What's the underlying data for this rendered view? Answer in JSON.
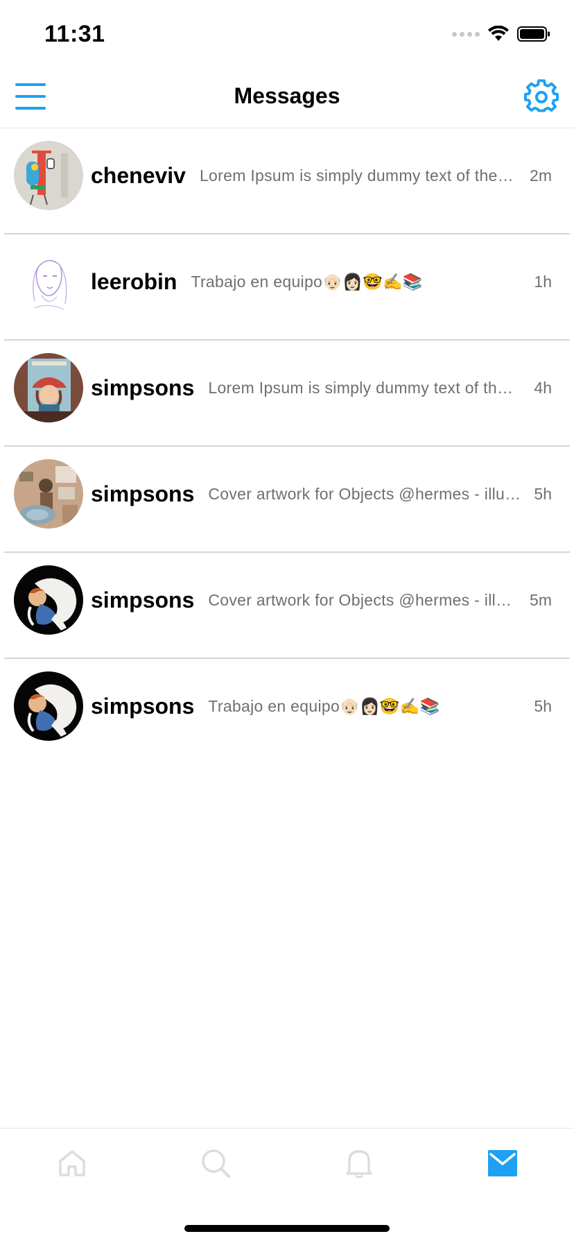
{
  "status_bar": {
    "time": "11:31"
  },
  "header": {
    "title": "Messages"
  },
  "messages": [
    {
      "username": "cheneviv",
      "preview": "Lorem Ipsum is simply dummy text of the printing and typesetting industry",
      "time": "2m",
      "avatar_icon": "robot-illustration-avatar"
    },
    {
      "username": "leerobin",
      "preview": "Trabajo en equipo👴🏻👩🏻🤓✍️📚",
      "time": "1h",
      "avatar_icon": "sketch-portrait-avatar"
    },
    {
      "username": "simpsons",
      "preview": "Lorem Ipsum is simply dummy text of the printing and typesetting industry",
      "time": "4h",
      "avatar_icon": "book-girl-avatar"
    },
    {
      "username": "simpsons",
      "preview": "Cover artwork for Objects @hermes - illustration",
      "time": "5h",
      "avatar_icon": "room-illustration-avatar"
    },
    {
      "username": "simpsons",
      "preview": "Cover artwork for Objects @hermes - illustration",
      "time": "5m",
      "avatar_icon": "sleeping-figure-avatar"
    },
    {
      "username": "simpsons",
      "preview": "Trabajo en equipo👴🏻👩🏻🤓✍️📚",
      "time": "5h",
      "avatar_icon": "sleeping-figure-avatar"
    }
  ],
  "tab_bar": {
    "tabs": [
      {
        "icon": "home-icon",
        "active": false
      },
      {
        "icon": "search-icon",
        "active": false
      },
      {
        "icon": "bell-icon",
        "active": false
      },
      {
        "icon": "mail-icon",
        "active": true
      }
    ]
  },
  "colors": {
    "accent": "#1da1f2",
    "muted_text": "#6f6f6f",
    "inactive_icon": "#d8dde2",
    "divider": "#d6d6d6"
  }
}
